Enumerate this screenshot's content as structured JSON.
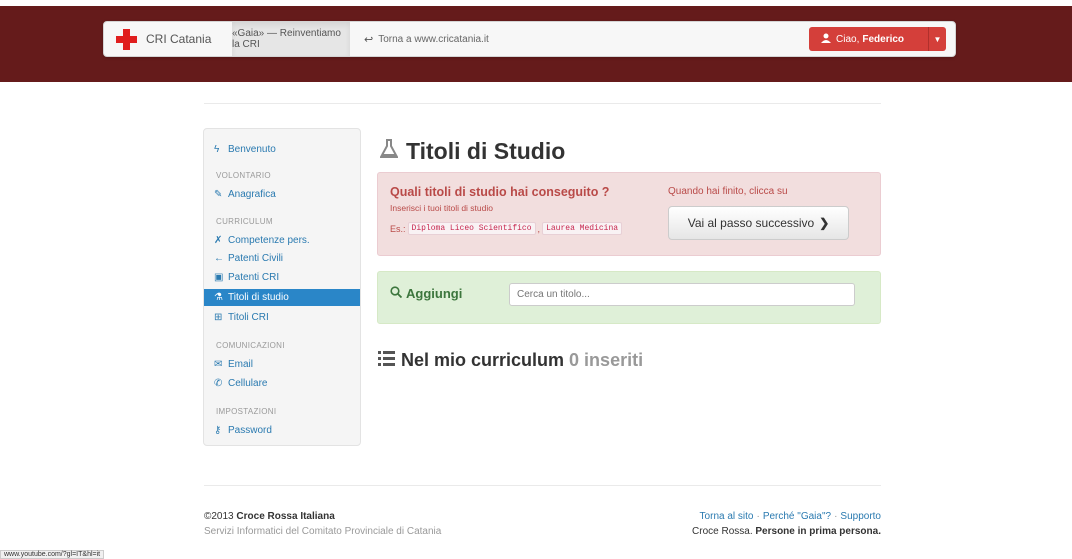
{
  "navbar": {
    "brand": "CRI Catania",
    "active_tab": "«Gaia» — Reinventiamo la CRI",
    "back_link": "Torna a www.cricatania.it",
    "user_greeting": "Ciao,",
    "user_name": "Federico"
  },
  "sidebar": {
    "welcome": "Benvenuto",
    "sections": {
      "volontario": "VOLONTARIO",
      "curriculum": "CURRICULUM",
      "comunicazioni": "COMUNICAZIONI",
      "impostazioni": "IMPOSTAZIONI"
    },
    "items": {
      "anagrafica": "Anagrafica",
      "competenze": "Competenze pers.",
      "patenti_civili": "Patenti Civili",
      "patenti_cri": "Patenti CRI",
      "titoli_studio": "Titoli di studio",
      "titoli_cri": "Titoli CRI",
      "email": "Email",
      "cellulare": "Cellulare",
      "password": "Password"
    }
  },
  "main": {
    "title": "Titoli di Studio",
    "alert": {
      "question": "Quali titoli di studio hai conseguito ?",
      "subtitle": "Inserisci i tuoi titoli di studio",
      "example_prefix": "Es.:",
      "example_1": "Diploma Liceo Scientifico",
      "example_2": "Laurea Medicina",
      "finished_text": "Quando hai finito, clicca su",
      "next_button": "Vai al passo successivo"
    },
    "add": {
      "label": "Aggiungi",
      "search_placeholder": "Cerca un titolo..."
    },
    "curriculum": {
      "heading": "Nel mio curriculum",
      "count": "0 inseriti"
    }
  },
  "footer": {
    "copyright_prefix": "©2013",
    "org": "Croce Rossa Italiana",
    "subtitle": "Servizi Informatici del Comitato Provinciale di Catania",
    "links": [
      "Torna al sito",
      "Perché \"Gaia\"?",
      "Supporto"
    ],
    "tagline_prefix": "Croce Rossa.",
    "tagline_bold": "Persone in prima persona."
  },
  "status_bar": "www.youtube.com/?gl=IT&hl=it",
  "colors": {
    "header_band": "#651b1b",
    "user_button": "#d43f3a",
    "sidebar_active": "#2a86c8",
    "alert_bg": "#f2dede",
    "success_bg": "#dff0d8"
  },
  "icons": [
    "red-cross-logo",
    "reply-arrow-icon",
    "user-icon",
    "caret-down-icon",
    "flask-icon",
    "search-icon",
    "list-icon"
  ]
}
